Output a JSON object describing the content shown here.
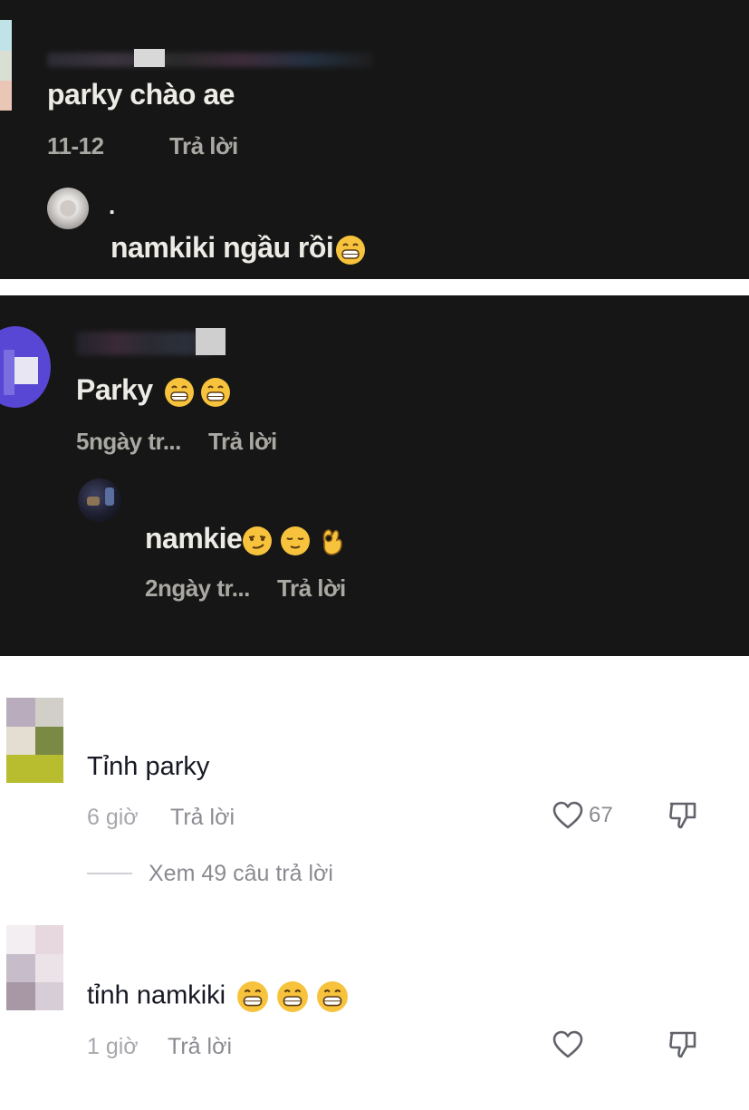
{
  "panel1": {
    "comment_text": "parky chào ae",
    "date": "11-12",
    "reply_label": "Trả lời",
    "reply": {
      "username": ".",
      "text": "namkiki ngầu rồi"
    }
  },
  "panel2": {
    "comment_text": "Parky",
    "time": "5ngày tr...",
    "reply_label": "Trả lời",
    "reply": {
      "text": "namkie",
      "time": "2ngày tr...",
      "reply_label": "Trả lời"
    }
  },
  "comments": [
    {
      "text": "Tỉnh parky",
      "time": "6 giờ",
      "reply_label": "Trả lời",
      "likes": "67",
      "view_replies": "Xem 49 câu trả lời"
    },
    {
      "text": "tỉnh namkiki",
      "time": "1 giờ",
      "reply_label": "Trả lời"
    }
  ],
  "icons": [
    "grin-emoji",
    "smirk-emoji",
    "relieved-emoji",
    "ok-hand-emoji",
    "heart-icon",
    "dislike-icon"
  ],
  "colors": {
    "dark_bg": "#161616",
    "light_bg": "#ffffff",
    "text_dark": "#161823",
    "text_secondary": "#8a8b91",
    "emoji_yellow": "#f7c23c"
  }
}
